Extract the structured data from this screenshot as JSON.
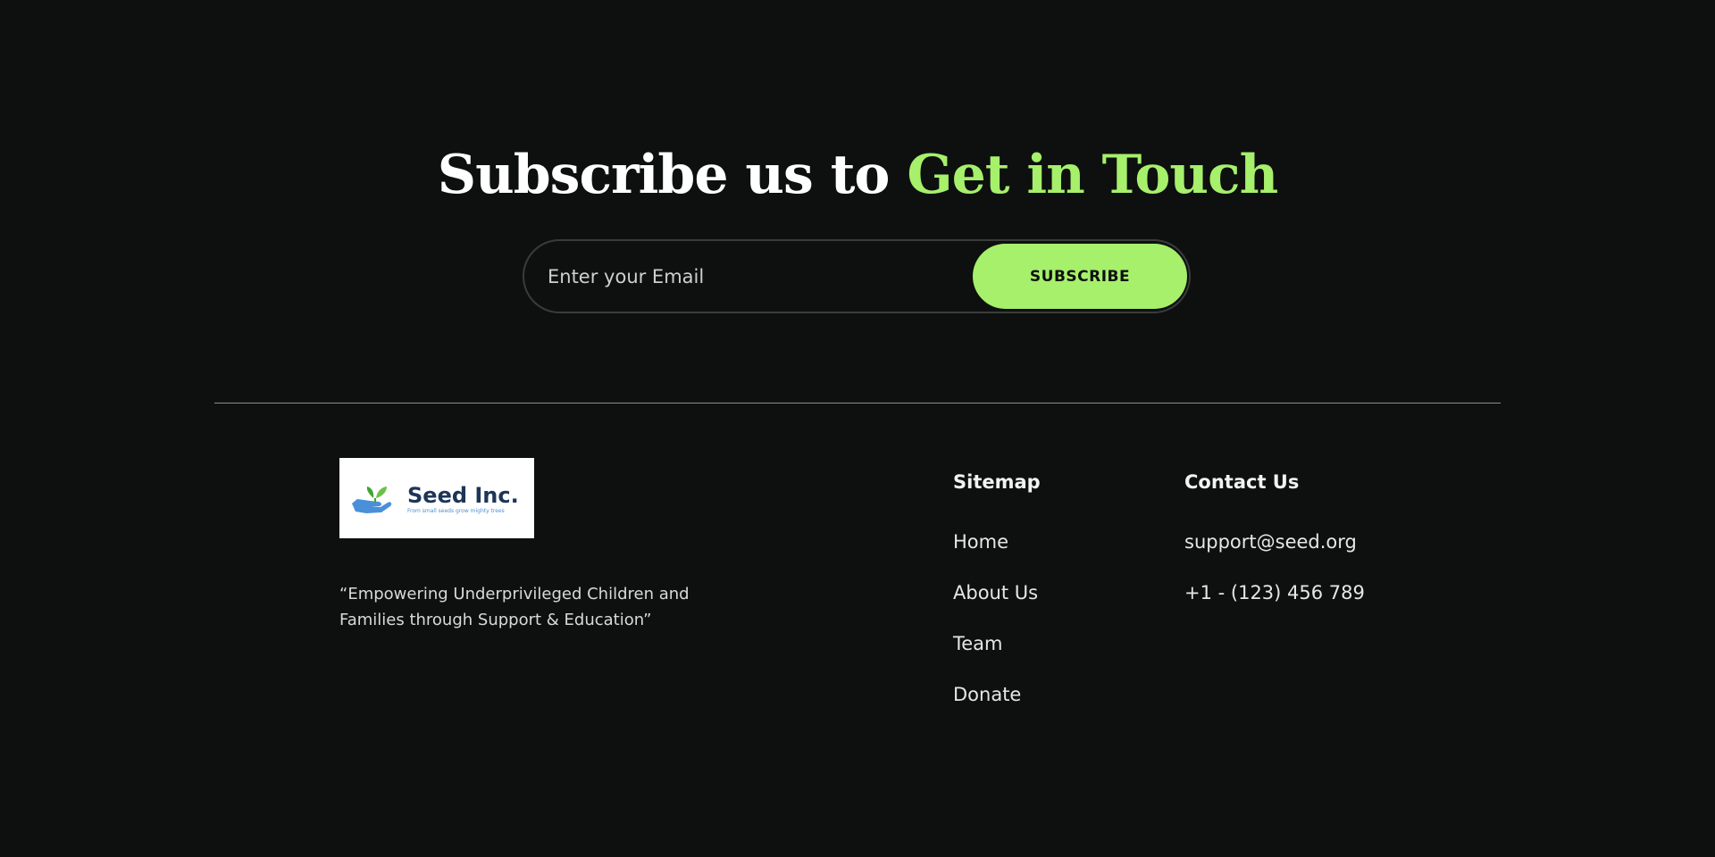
{
  "colors": {
    "background": "#0e100f",
    "accent": "#a6f06b",
    "text": "#ffffff"
  },
  "subscribe": {
    "heading_prefix": "Subscribe us to ",
    "heading_accent": "Get in Touch",
    "email_placeholder": "Enter your Email",
    "button_label": "SUBSCRIBE"
  },
  "brand": {
    "logo_name": "Seed Inc.",
    "logo_tagline": "From small seeds grow mighty trees",
    "logo_icon": "hand-with-sprout-icon",
    "tagline": "“Empowering Underprivileged Children and Families through Support & Education”"
  },
  "sitemap": {
    "title": "Sitemap",
    "links": [
      {
        "label": "Home"
      },
      {
        "label": "About Us"
      },
      {
        "label": "Team"
      },
      {
        "label": "Donate"
      }
    ]
  },
  "contact": {
    "title": "Contact Us",
    "items": [
      {
        "label": "support@seed.org"
      },
      {
        "label": "+1 - (123) 456 789"
      }
    ]
  }
}
